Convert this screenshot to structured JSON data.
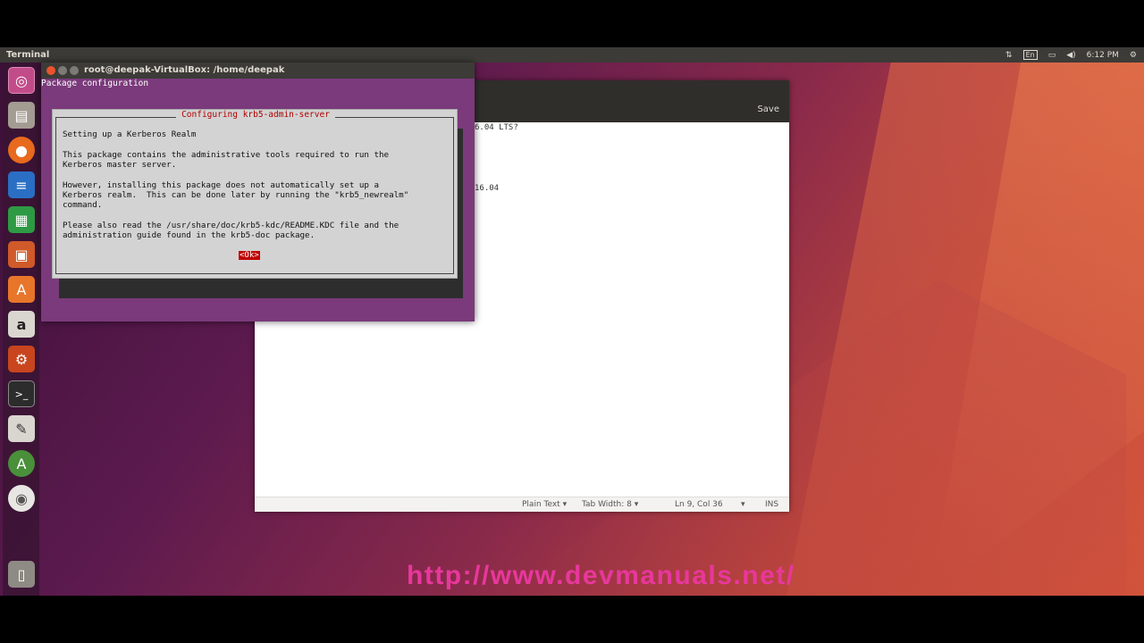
{
  "top_panel": {
    "app_title": "Terminal",
    "keyboard_indicator": "En",
    "time": "6:12 PM"
  },
  "terminal": {
    "title": "root@deepak-VirtualBox: /home/deepak",
    "header_line": "Package configuration",
    "dialog": {
      "title": "Configuring krb5-admin-server",
      "lines": [
        "Setting up a Kerberos Realm",
        "This package contains the administrative tools required to run the",
        "Kerberos master server.",
        "However, installing this package does not automatically set up a",
        "Kerberos realm.  This can be done later by running the \"krb5_newrealm\"",
        "command.",
        "Please also read the /usr/share/doc/krb5-kdc/README.KDC file and the",
        "administration guide found in the krb5-doc package."
      ],
      "ok_label": "<Ok>"
    }
  },
  "gedit": {
    "save_label": "Save",
    "visible_text": [
      "6.04 LTS?",
      "16.04"
    ],
    "status": {
      "language": "Plain Text",
      "tab_width": "Tab Width: 8",
      "position": "Ln 9, Col 36",
      "mode": "INS"
    }
  },
  "watermark": "http://www.devmanuals.net/",
  "colors": {
    "panel": "#3c3b37",
    "terminal_bg": "#7a3a7b",
    "dialog_bg": "#d3d3d3",
    "dialog_title": "#b00000",
    "ok_button": "#c00000",
    "watermark": "#e8379c"
  },
  "launcher_icons": [
    "ubuntu-dash-icon",
    "files-icon",
    "firefox-icon",
    "writer-icon",
    "calc-icon",
    "impress-icon",
    "software-center-icon",
    "amazon-icon",
    "system-settings-icon",
    "terminal-icon",
    "text-editor-icon",
    "software-updater-icon",
    "dvd-icon",
    "trash-icon"
  ]
}
